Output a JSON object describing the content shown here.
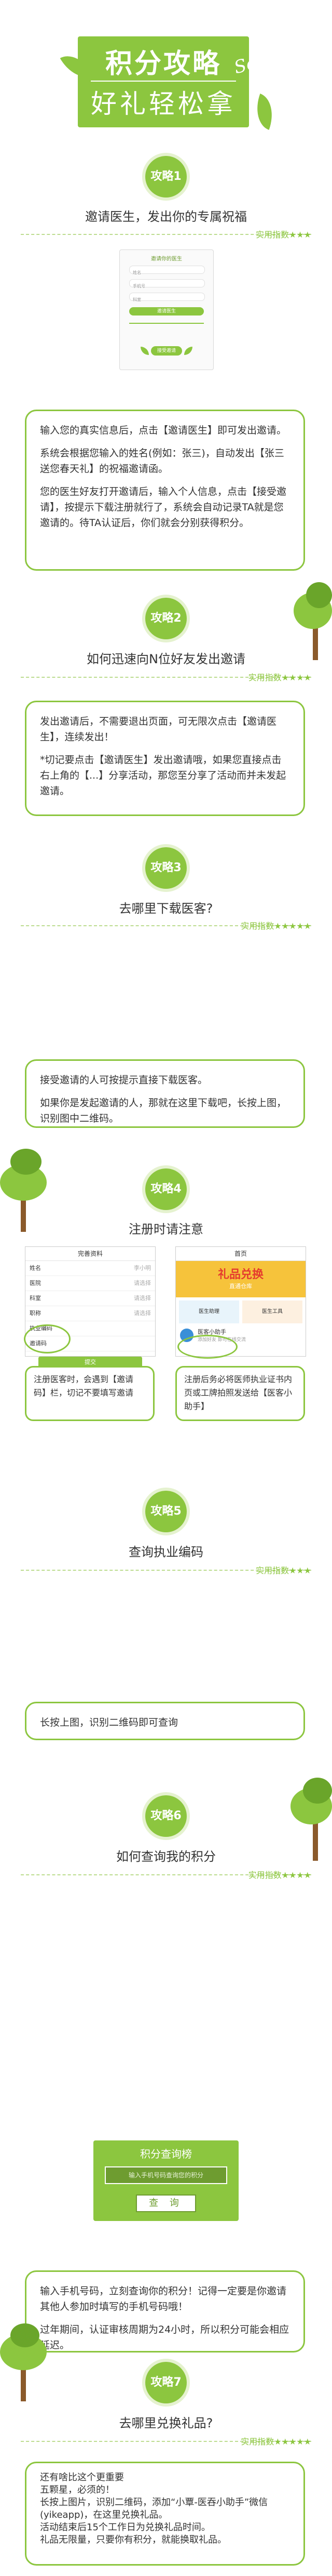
{
  "header": {
    "title_line1": "积分攻略",
    "title_line2": "好礼轻松拿",
    "tag": "So easy"
  },
  "rating_label": "实用指数",
  "sections": [
    {
      "badge": "攻略1",
      "title": "邀请医生，发出你的专属祝福",
      "stars": "★★★",
      "box_paras": [
        "输入您的真实信息后，点击【邀请医生】即可发出邀请。",
        "系统会根据您输入的姓名(例如：张三)，自动发出【张三送您春天礼】的祝福邀请函。",
        "您的医生好友打开邀请后，输入个人信息，点击【接受邀请】，按提示下载注册就行了，系统会自动记录TA就是您邀请的。待TA认证后，你们就会分别获得积分。"
      ]
    },
    {
      "badge": "攻略2",
      "title": "如何迅速向N位好友发出邀请",
      "stars": "★★★★",
      "box_paras": [
        "发出邀请后，不需要退出页面，可无限次点击【邀请医生】，连续发出！",
        "*切记要点击【邀请医生】发出邀请哦，如果您直接点击右上角的【...】分享活动，那您至分享了活动而并未发起邀请。"
      ]
    },
    {
      "badge": "攻略3",
      "title": "去哪里下载医客?",
      "stars": "★★★★★",
      "box_paras": [
        "接受邀请的人可按提示直接下载医客。",
        "如果你是发起邀请的人，那就在这里下载吧，长按上图，识别图中二维码。"
      ]
    },
    {
      "badge": "攻略4",
      "title": "注册时请注意",
      "stars": "",
      "box_paras": []
    },
    {
      "badge": "攻略5",
      "title": "查询执业编码",
      "stars": "★★★",
      "box_paras": [
        "长按上图，识别二维码即可查询"
      ]
    },
    {
      "badge": "攻略6",
      "title": "如何查询我的积分",
      "stars": "★★★★",
      "box_paras": [
        "输入手机号码，立刻查询你的积分！记得一定要是你邀请其他人参加时填写的手机号码哦！",
        "过年期间，认证审核周期为24小时，所以积分可能会相应延迟。"
      ]
    },
    {
      "badge": "攻略7",
      "title": "去哪里兑换礼品?",
      "stars": "★★★★★",
      "box_paras": [
        "还有啥比这个更重要",
        "五颗星，必须的！",
        "长按上图片，识别二维码，添加“小覃-医吞小助手”微信(yikeapp)，在这里兑换礼品。",
        "活动结束后15个工作日为兑换礼品时间。",
        "礼品无限量，只要你有积分，就能换取礼品。"
      ]
    }
  ],
  "invite_mock": {
    "title": "邀请你的医生",
    "fields": [
      "姓名",
      "手机号",
      "科室"
    ],
    "button": "邀请医生",
    "footer": "接受邀请"
  },
  "tip4": {
    "form": {
      "title": "完善资料",
      "rows": [
        {
          "label": "姓名",
          "value": "李小明"
        },
        {
          "label": "医院",
          "value": "请选择"
        },
        {
          "label": "科室",
          "value": "请选择"
        },
        {
          "label": "职称",
          "value": "请选择"
        },
        {
          "label": "执业编码",
          "value": ""
        }
      ],
      "invite_row": "邀请码",
      "submit": "提交"
    },
    "home": {
      "title": "首页",
      "banner_line1": "礼品兑换",
      "banner_line2": "直通仓库",
      "card1": "医生助理",
      "card2": "医生工具",
      "contact": "医客小助手",
      "contact_sub": "添加好友 即可在线交流"
    },
    "note_left": "注册医客时，会遇到【邀请码】栏，切记不要填写邀请",
    "note_right": "注册后务必将医师执业证书内页或工牌拍照发送给【医客小助手】"
  },
  "query_panel": {
    "title": "积分查询榜",
    "placeholder": "输入手机号码查询您的积分",
    "button": "查 询"
  }
}
